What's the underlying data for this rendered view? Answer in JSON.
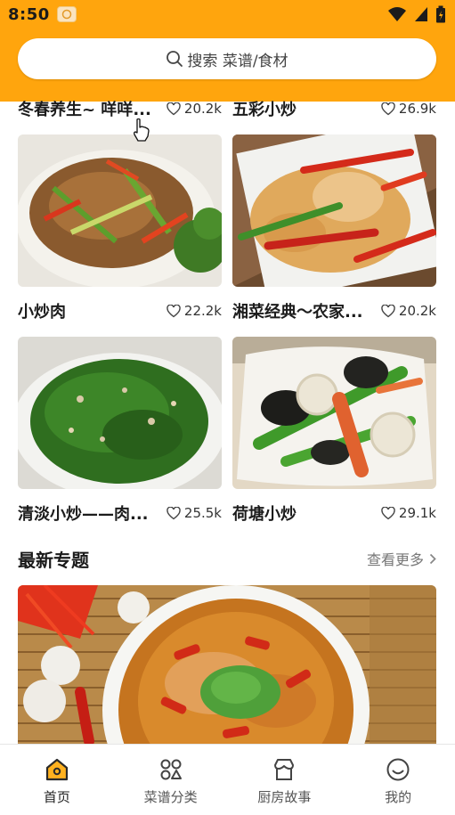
{
  "status_bar": {
    "time": "8:50"
  },
  "search": {
    "label": "搜索 菜谱/食材"
  },
  "recipes": [
    {
      "title": "冬春养生~ 咩咩...",
      "likes": "20.2k"
    },
    {
      "title": "五彩小炒",
      "likes": "26.9k"
    },
    {
      "title": "小炒肉",
      "likes": "22.2k"
    },
    {
      "title": "湘菜经典～农家...",
      "likes": "20.2k"
    },
    {
      "title": "清淡小炒——肉...",
      "likes": "25.5k"
    },
    {
      "title": "荷塘小炒",
      "likes": "29.1k"
    }
  ],
  "section": {
    "title": "最新专题",
    "more": "查看更多"
  },
  "nav": [
    {
      "label": "首页",
      "icon": "home-icon",
      "active": true
    },
    {
      "label": "菜谱分类",
      "icon": "category-icon",
      "active": false
    },
    {
      "label": "厨房故事",
      "icon": "story-icon",
      "active": false
    },
    {
      "label": "我的",
      "icon": "profile-icon",
      "active": false
    }
  ],
  "colors": {
    "accent": "#ffa50d",
    "background": "#ffffff",
    "text": "#1c1c1c"
  }
}
